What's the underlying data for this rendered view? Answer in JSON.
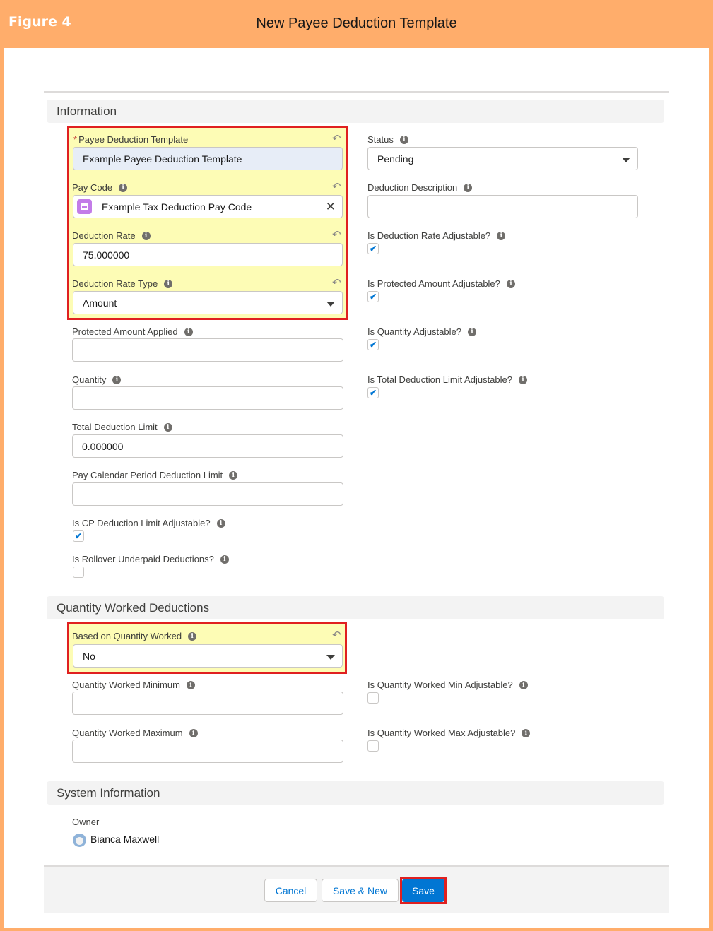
{
  "figure": {
    "title": "Figure 4"
  },
  "modal": {
    "title": "New Payee Deduction Template"
  },
  "sections": {
    "information": "Information",
    "quantity_worked": "Quantity Worked Deductions",
    "system": "System Information"
  },
  "fields": {
    "payee_template": {
      "required_mark": "*",
      "label": "Payee Deduction Template",
      "value": "Example Payee Deduction Template"
    },
    "pay_code": {
      "label": "Pay Code",
      "value": "Example Tax Deduction Pay Code"
    },
    "deduction_rate": {
      "label": "Deduction Rate",
      "value": "75.000000"
    },
    "deduction_rate_type": {
      "label": "Deduction Rate Type",
      "value": "Amount"
    },
    "protected_amount_applied": {
      "label": "Protected Amount Applied",
      "value": ""
    },
    "quantity": {
      "label": "Quantity",
      "value": ""
    },
    "total_deduction_limit": {
      "label": "Total Deduction Limit",
      "value": "0.000000"
    },
    "pay_calendar_period_limit": {
      "label": "Pay Calendar Period Deduction Limit",
      "value": ""
    },
    "is_cp_limit_adjustable": {
      "label": "Is CP Deduction Limit Adjustable?",
      "checked": true
    },
    "is_rollover_underpaid": {
      "label": "Is Rollover Underpaid Deductions?",
      "checked": false
    },
    "status": {
      "label": "Status",
      "value": "Pending"
    },
    "deduction_description": {
      "label": "Deduction Description",
      "value": ""
    },
    "is_rate_adjustable": {
      "label": "Is Deduction Rate Adjustable?",
      "checked": true
    },
    "is_protected_adjustable": {
      "label": "Is Protected Amount Adjustable?",
      "checked": true
    },
    "is_quantity_adjustable": {
      "label": "Is Quantity Adjustable?",
      "checked": true
    },
    "is_total_limit_adjustable": {
      "label": "Is Total Deduction Limit Adjustable?",
      "checked": true
    },
    "based_on_quantity_worked": {
      "label": "Based on Quantity Worked",
      "value": "No"
    },
    "qw_minimum": {
      "label": "Quantity Worked Minimum",
      "value": ""
    },
    "qw_maximum": {
      "label": "Quantity Worked Maximum",
      "value": ""
    },
    "is_qw_min_adjustable": {
      "label": "Is Quantity Worked Min Adjustable?",
      "checked": false
    },
    "is_qw_max_adjustable": {
      "label": "Is Quantity Worked Max Adjustable?",
      "checked": false
    },
    "owner": {
      "label": "Owner",
      "value": "Bianca Maxwell"
    }
  },
  "buttons": {
    "cancel": "Cancel",
    "save_new": "Save & New",
    "save": "Save"
  },
  "glyphs": {
    "info": "i",
    "undo": "↶",
    "check": "✔",
    "clear": "✕"
  },
  "colors": {
    "highlight_fill": "#fdfcb5",
    "highlight_border": "#e02020",
    "primary": "#0176d3",
    "frame": "#ffad6b"
  }
}
